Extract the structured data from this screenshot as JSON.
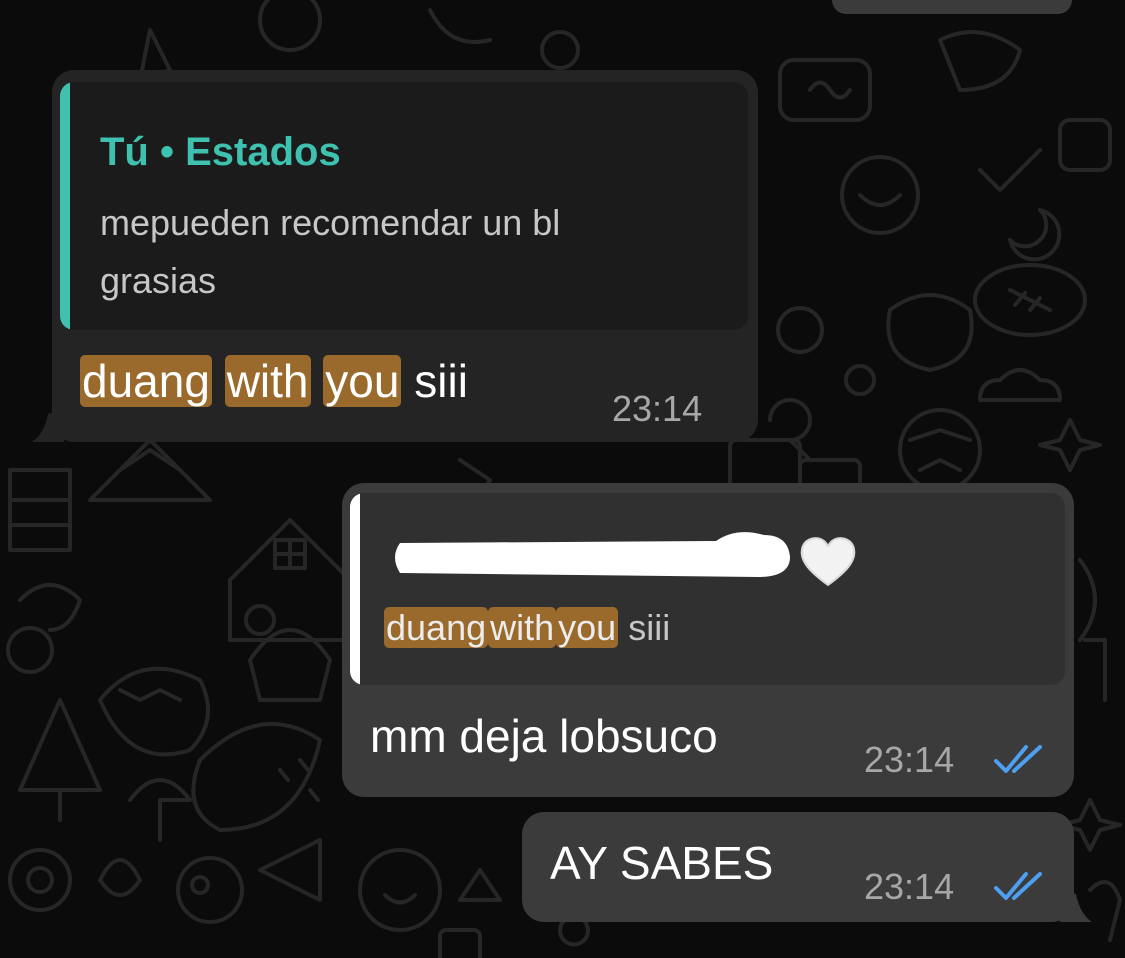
{
  "colors": {
    "background": "#0b0b0b",
    "incoming_bubble": "#242424",
    "outgoing_bubble": "#3b3b3b",
    "status_accent": "#3fc1b0",
    "highlight": "#9a6a2c",
    "read_ticks": "#4f9ff0"
  },
  "messages": [
    {
      "direction": "incoming",
      "quote": {
        "title": "Tú • Estados",
        "line1": "mepueden recomendar un bl",
        "line2": "grasias"
      },
      "text_parts": [
        "duang",
        "with",
        "you",
        "siii"
      ],
      "time": "23:14"
    },
    {
      "direction": "outgoing",
      "quote": {
        "sender_icon": "white-heart-icon",
        "text_parts": [
          "duang",
          "with",
          "you",
          "siii"
        ]
      },
      "text": "mm deja lobsuco",
      "time": "23:14",
      "status": "read-double-check-icon"
    },
    {
      "direction": "outgoing",
      "text": "AY SABES",
      "time": "23:14",
      "status": "read-double-check-icon"
    }
  ]
}
